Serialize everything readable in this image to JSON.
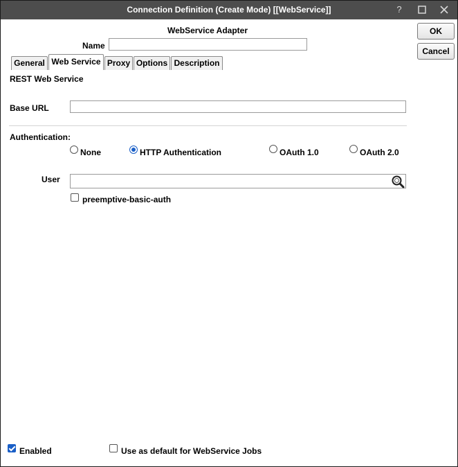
{
  "window": {
    "title": "Connection Definition (Create Mode) [[WebService]]"
  },
  "titlebar": {
    "help": "?",
    "maximize": "☐",
    "close": "✕"
  },
  "header": {
    "adapter": "WebService Adapter",
    "name_label": "Name",
    "name_value": ""
  },
  "buttons": {
    "ok": "OK",
    "cancel": "Cancel"
  },
  "tabs": [
    {
      "label": "General",
      "active": false
    },
    {
      "label": "Web Service",
      "active": true
    },
    {
      "label": "Proxy",
      "active": false
    },
    {
      "label": "Options",
      "active": false
    },
    {
      "label": "Description",
      "active": false
    }
  ],
  "webservice": {
    "section_title": "REST Web Service",
    "base_url_label": "Base URL",
    "base_url_value": "",
    "auth_label": "Authentication:",
    "auth_options": [
      {
        "label": "None",
        "selected": false
      },
      {
        "label": "HTTP Authentication",
        "selected": true
      },
      {
        "label": "OAuth 1.0",
        "selected": false
      },
      {
        "label": "OAuth 2.0",
        "selected": false
      }
    ],
    "user_label": "User",
    "user_value": "",
    "preemptive_label": "preemptive-basic-auth",
    "preemptive_checked": false
  },
  "footer": {
    "enabled_label": "Enabled",
    "enabled_checked": true,
    "default_label": "Use as default for WebService Jobs",
    "default_checked": false
  }
}
